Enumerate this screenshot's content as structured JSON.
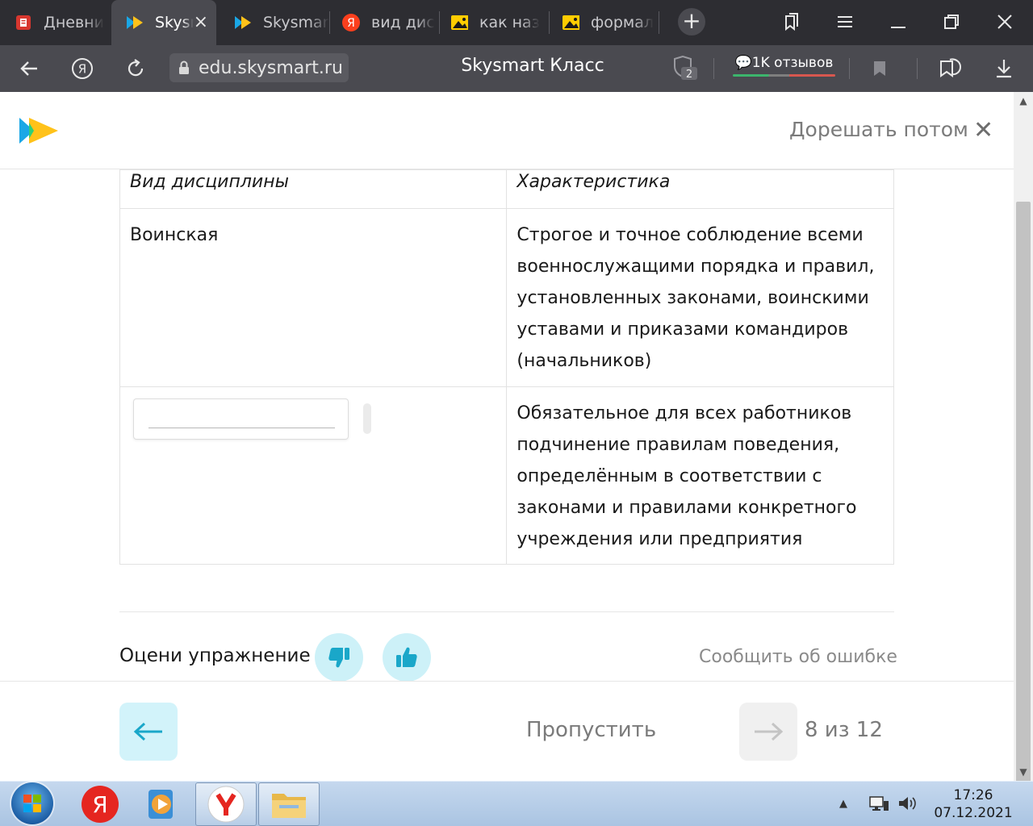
{
  "browser": {
    "tabs": [
      {
        "label": "Дневни",
        "icon": "diary-icon",
        "active": false
      },
      {
        "label": "Skysm",
        "icon": "skysmart-icon",
        "active": true
      },
      {
        "label": "Skysmar",
        "icon": "skysmart-icon",
        "active": false
      },
      {
        "label": "вид дис",
        "icon": "yandex-icon",
        "active": false
      },
      {
        "label": "как наз",
        "icon": "image-icon",
        "active": false
      },
      {
        "label": "формал",
        "icon": "image-icon",
        "active": false
      }
    ],
    "address": "edu.skysmart.ru",
    "page_title": "Skysmart Класс",
    "badge_count": "2",
    "reviews_label": "1K отзывов"
  },
  "header": {
    "solve_later": "Дорешать потом"
  },
  "table": {
    "headers": [
      "Вид дисциплины",
      "Характеристика"
    ],
    "rows": [
      {
        "type": "Воинская",
        "description": "Строгое и точное соблюдение всеми военнослужащими порядка и правил, установленных законами, воинскими уставами и приказами командиров (начальников)"
      },
      {
        "type": "",
        "description": "Обязательное для всех работников подчинение правилам поведения, определённым в соответствии с законами и правилами конкретного учреждения или предприятия"
      }
    ]
  },
  "rating": {
    "label": "Оцени упражнение",
    "report": "Сообщить об ошибке"
  },
  "navigation": {
    "skip": "Пропустить",
    "counter": "8 из 12"
  },
  "taskbar": {
    "time": "17:26",
    "date": "07.12.2021"
  },
  "colors": {
    "accent_light": "#cdf1f8",
    "accent_icon": "#1aa7c9",
    "chrome_dark": "#2d2d32",
    "chrome_mid": "#4a4a50"
  }
}
